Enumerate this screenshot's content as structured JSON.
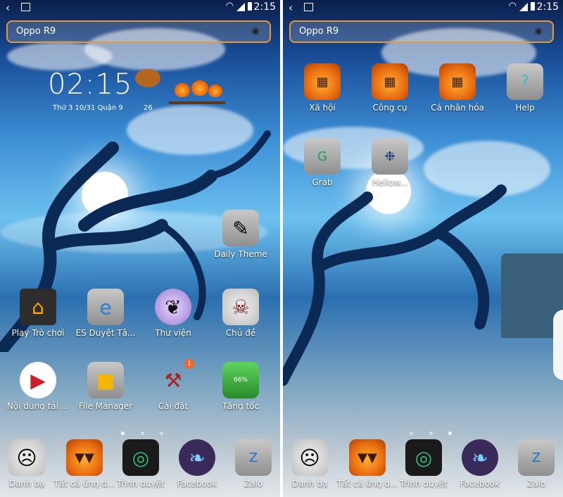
{
  "status": {
    "time": "2:15"
  },
  "search": {
    "placeholder": "Oppo R9"
  },
  "widget": {
    "clock": "02:15",
    "date": "Thứ 3 10/31 Quận 9",
    "temperature": "26"
  },
  "left": {
    "rows": [
      [
        {
          "label": "Daily Theme",
          "icon": "tombstone-theme-icon"
        }
      ],
      [
        {
          "label": "Play Trò chơi",
          "icon": "haunted-house-icon"
        },
        {
          "label": "ES Duyệt Tậ...",
          "icon": "tombstone-es-icon"
        },
        {
          "label": "Thư viện",
          "icon": "bat-moon-icon"
        },
        {
          "label": "Chủ đề",
          "icon": "skull-icon"
        }
      ],
      [
        {
          "label": "Nội dung tải ...",
          "icon": "download-icon"
        },
        {
          "label": "File Manager",
          "icon": "tombstone-folder-icon"
        },
        {
          "label": "Cài đặt",
          "icon": "axe-icon",
          "badge": "1"
        },
        {
          "label": "Tăng tốc",
          "icon": "tombstone-boost-icon",
          "percent": "66%"
        }
      ]
    ]
  },
  "right": {
    "rows": [
      [
        {
          "label": "Xã hội",
          "icon": "pumpkin-social-icon"
        },
        {
          "label": "Công cụ",
          "icon": "pumpkin-tools-icon"
        },
        {
          "label": "Cá nhân hóa",
          "icon": "pumpkin-personal-icon"
        },
        {
          "label": "Help",
          "icon": "tombstone-help-icon"
        }
      ],
      [
        {
          "label": "Grab",
          "icon": "tombstone-grab-icon"
        },
        {
          "label": "Hellow...",
          "icon": "tombstone-hellow-icon"
        }
      ]
    ]
  },
  "dock": [
    {
      "label": "Danh bạ",
      "icon": "jack-skull-icon"
    },
    {
      "label": "Tất cả ứng d...",
      "icon": "pumpkin-icon"
    },
    {
      "label": "Trình duyệt",
      "icon": "speaker-box-icon"
    },
    {
      "label": "Facebook",
      "icon": "black-cat-icon"
    },
    {
      "label": "Zalo",
      "icon": "tombstone-zalo-icon"
    }
  ],
  "colors": {
    "search_border": "#e59a35",
    "badge": "#f26522"
  }
}
